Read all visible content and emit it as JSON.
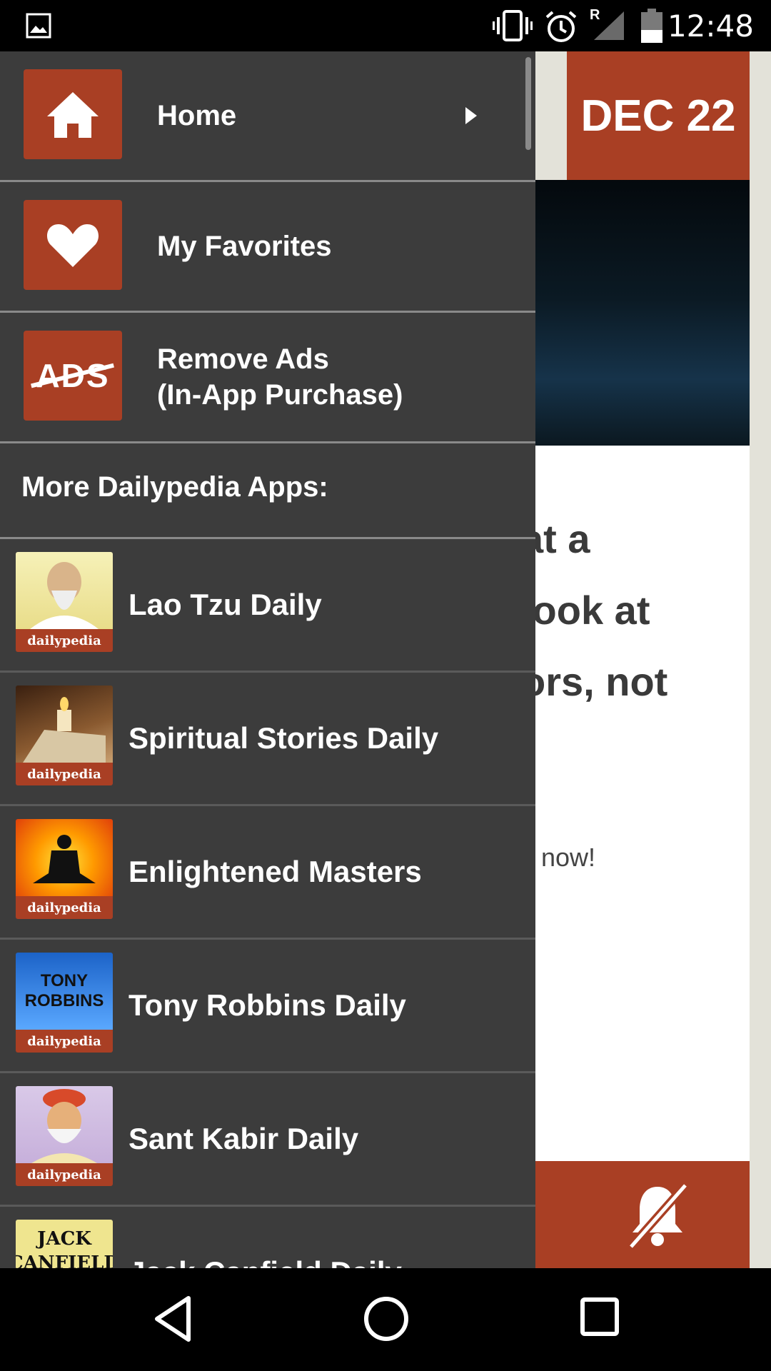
{
  "status_bar": {
    "time": "12:48",
    "network_letter": "R"
  },
  "background": {
    "date": "DEC 22",
    "quote_lines": [
      "at a",
      "look at",
      "ors, not"
    ],
    "small_text": "s now!"
  },
  "drawer": {
    "nav_items": [
      {
        "label": "Home",
        "icon": "home-icon"
      },
      {
        "label": "My Favorites",
        "icon": "heart-icon"
      },
      {
        "label": "Remove Ads\n(In-App Purchase)",
        "icon": "ads-icon",
        "icon_text": "ADS"
      }
    ],
    "section_title": "More Dailypedia Apps:",
    "brand": "dailypedia",
    "apps": [
      {
        "label": "Lao Tzu Daily",
        "thumb": "lao-tzu"
      },
      {
        "label": "Spiritual Stories Daily",
        "thumb": "candle"
      },
      {
        "label": "Enlightened Masters",
        "thumb": "meditation"
      },
      {
        "label": "Tony Robbins Daily",
        "thumb": "tony",
        "thumb_text": "TONY\nROBBINS"
      },
      {
        "label": "Sant Kabir Daily",
        "thumb": "kabir"
      },
      {
        "label": "Jack Canfield Daily",
        "thumb": "jack",
        "thumb_text": "JACK\nCANFIELD"
      }
    ]
  },
  "colors": {
    "accent": "#a93f24",
    "drawer_bg": "#3c3c3c",
    "divider": "#8a8a8a"
  }
}
